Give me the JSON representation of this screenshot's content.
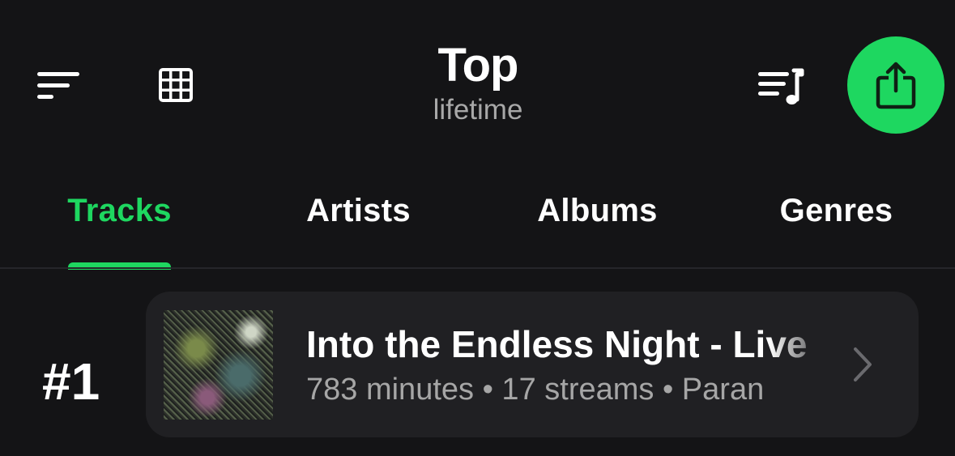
{
  "header": {
    "title": "Top",
    "subtitle": "lifetime",
    "icons": {
      "filter": "filter-icon",
      "grid": "grid-icon",
      "playlist": "playlist-music-icon",
      "share": "share-icon"
    },
    "accent_color": "#1ed760"
  },
  "tabs": [
    {
      "label": "Tracks",
      "active": true
    },
    {
      "label": "Artists",
      "active": false
    },
    {
      "label": "Albums",
      "active": false
    },
    {
      "label": "Genres",
      "active": false
    }
  ],
  "tracks": [
    {
      "rank": "#1",
      "title": "Into the Endless Night - Live",
      "meta": "783 minutes • 17 streams • Paran",
      "icon": "chevron-right-icon"
    }
  ]
}
